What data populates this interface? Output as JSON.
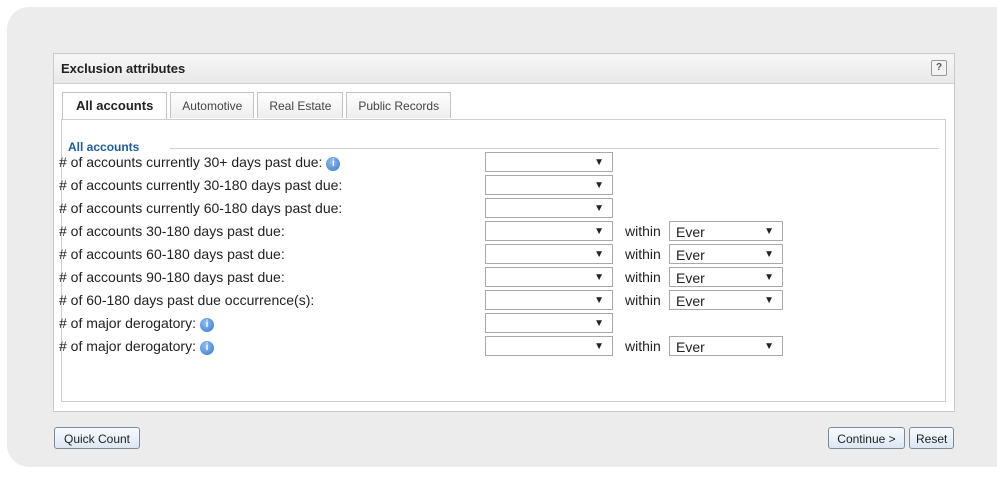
{
  "panel": {
    "title": "Exclusion attributes",
    "help_label": "?"
  },
  "tabs": [
    {
      "label": "All accounts",
      "active": true
    },
    {
      "label": "Automotive",
      "active": false
    },
    {
      "label": "Real Estate",
      "active": false
    },
    {
      "label": "Public Records",
      "active": false
    }
  ],
  "section": {
    "legend": "All accounts",
    "rows": [
      {
        "label": "# of accounts currently 30+ days past due:",
        "info": true,
        "value": "",
        "within_label": "",
        "within_value": ""
      },
      {
        "label": "# of accounts currently 30-180 days past due:",
        "info": false,
        "value": "",
        "within_label": "",
        "within_value": ""
      },
      {
        "label": "# of accounts currently 60-180 days past due:",
        "info": false,
        "value": "",
        "within_label": "",
        "within_value": ""
      },
      {
        "label": "# of accounts 30-180 days past due:",
        "info": false,
        "value": "",
        "within_label": "within",
        "within_value": "Ever"
      },
      {
        "label": "# of accounts 60-180 days past due:",
        "info": false,
        "value": "",
        "within_label": "within",
        "within_value": "Ever"
      },
      {
        "label": "# of accounts 90-180 days past due:",
        "info": false,
        "value": "",
        "within_label": "within",
        "within_value": "Ever"
      },
      {
        "label": "# of 60-180 days past due occurrence(s):",
        "info": false,
        "value": "",
        "within_label": "within",
        "within_value": "Ever"
      },
      {
        "label": "# of major derogatory:",
        "info": true,
        "value": "",
        "within_label": "",
        "within_value": ""
      },
      {
        "label": "# of major derogatory:",
        "info": true,
        "value": "",
        "within_label": "within",
        "within_value": "Ever"
      }
    ]
  },
  "icons": {
    "info": "info-icon",
    "dropdown": "dropdown-arrow-icon"
  },
  "glyphs": {
    "dropdown_arrow": "▼",
    "info": "i"
  },
  "buttons": {
    "quick_count": "Quick Count",
    "continue": "Continue >",
    "reset": "Reset"
  },
  "colors": {
    "legend": "#1f5b99",
    "info_icon": "#3a79c9"
  }
}
